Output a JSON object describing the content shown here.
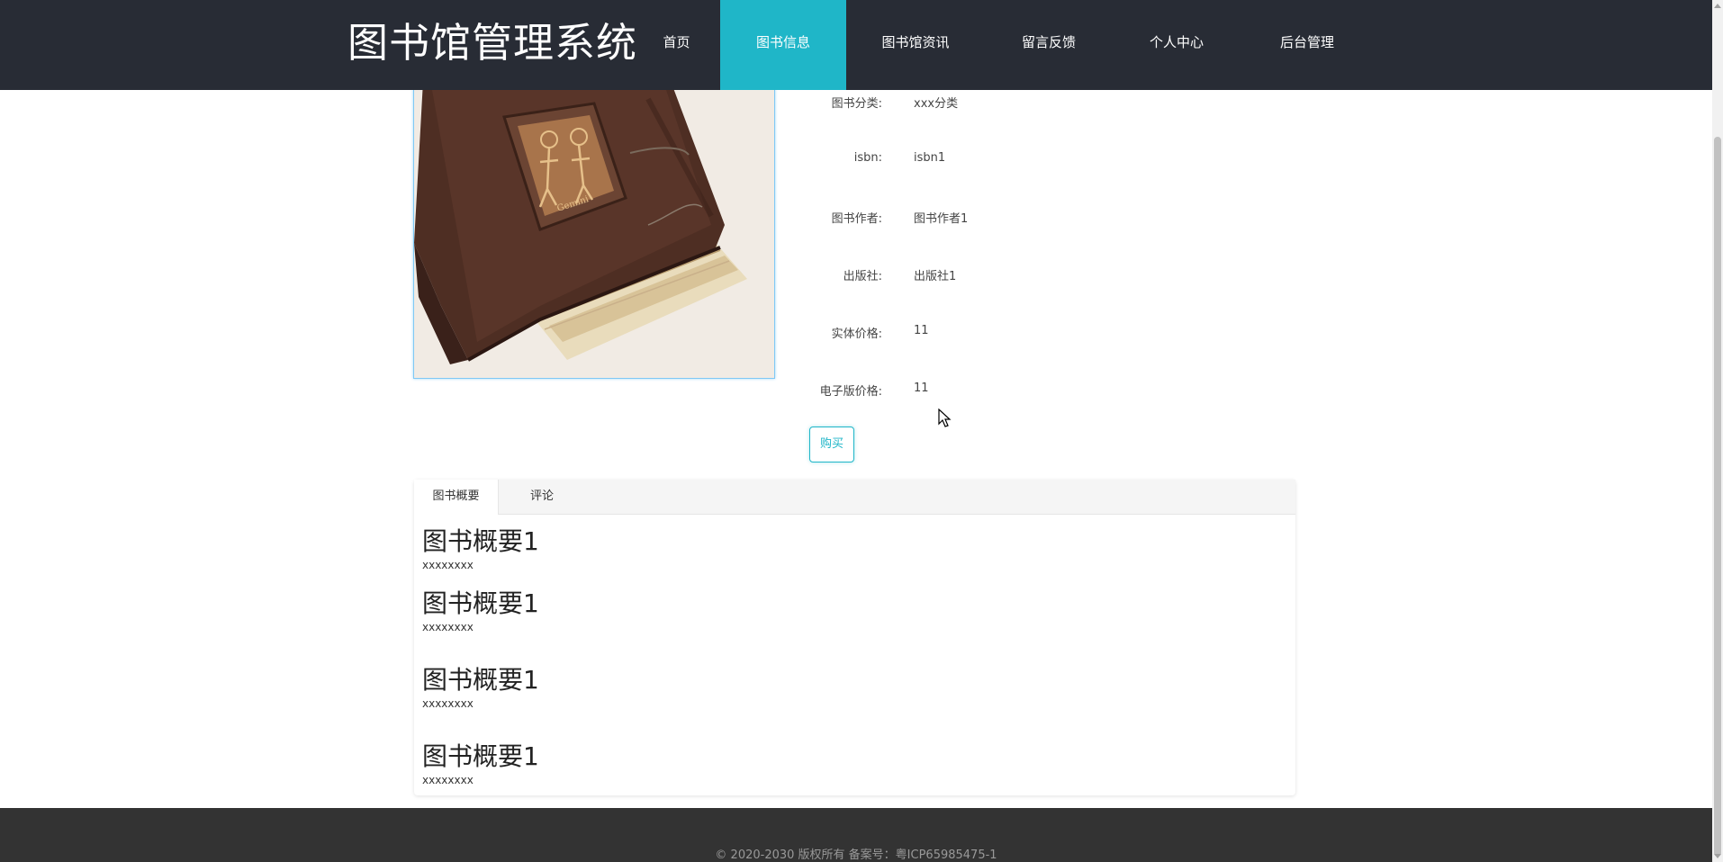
{
  "header": {
    "logo": "图书馆管理系统",
    "nav": [
      {
        "label": "首页"
      },
      {
        "label": "图书信息"
      },
      {
        "label": "图书馆资讯"
      },
      {
        "label": "留言反馈"
      },
      {
        "label": "个人中心"
      },
      {
        "label": "后台管理"
      }
    ],
    "active_nav": "图书信息"
  },
  "book": {
    "image_icon": "book-image",
    "fields": [
      {
        "label": "图书分类:",
        "value": "xxx分类"
      },
      {
        "label": "isbn:",
        "value": "isbn1"
      },
      {
        "label": "图书作者:",
        "value": "图书作者1"
      },
      {
        "label": "出版社:",
        "value": "出版社1"
      },
      {
        "label": "实体价格:",
        "value": "11"
      },
      {
        "label": "电子版价格:",
        "value": "11"
      }
    ],
    "buy_label": "购买"
  },
  "tabs": {
    "items": [
      {
        "label": "图书概要"
      },
      {
        "label": "评论"
      }
    ],
    "active": "图书概要",
    "summaries": [
      {
        "title": "图书概要1",
        "text": "xxxxxxxx"
      },
      {
        "title": "图书概要1",
        "text": "xxxxxxxx"
      },
      {
        "title": "图书概要1",
        "text": "xxxxxxxx"
      },
      {
        "title": "图书概要1",
        "text": "xxxxxxxx"
      }
    ]
  },
  "footer": {
    "copyright": "© 2020-2030 版权所有 备案号：粤ICP65985475-1"
  },
  "colors": {
    "header_bg": "#282c35",
    "accent": "#1fb6c8",
    "footer_bg": "#333333"
  }
}
